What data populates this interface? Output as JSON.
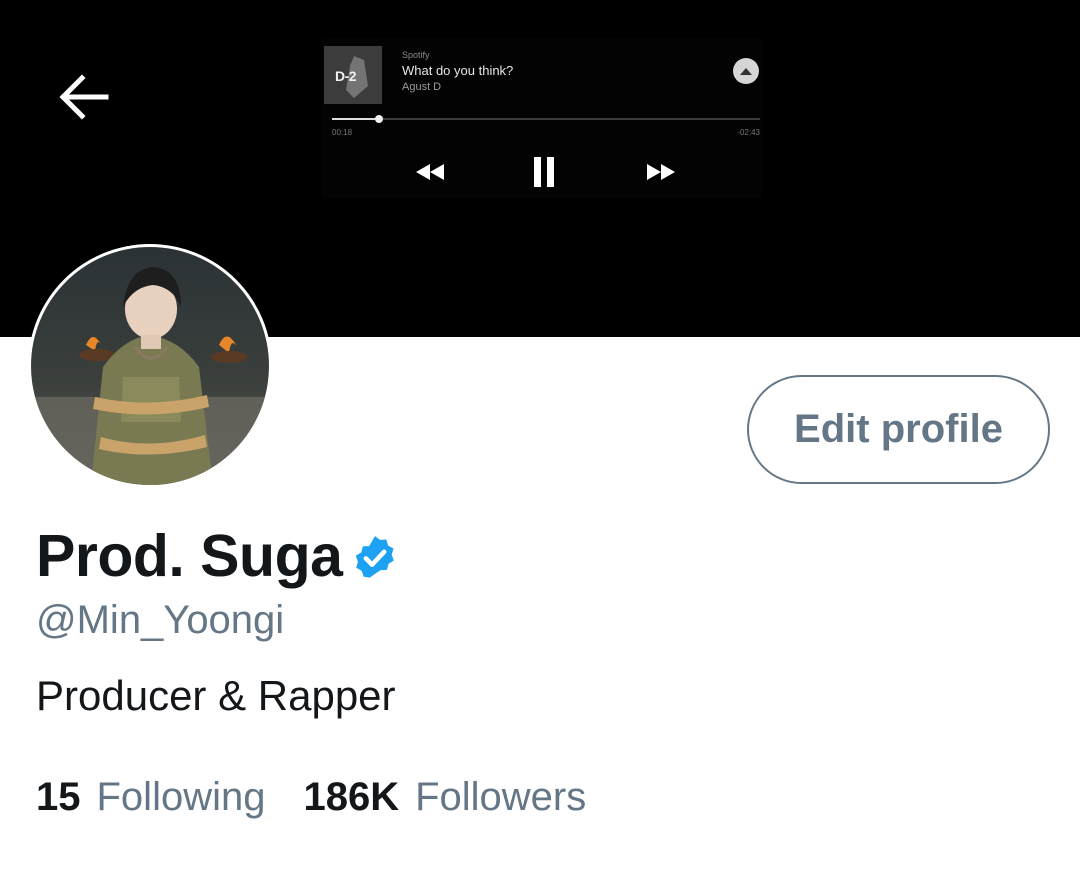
{
  "header": {
    "back_icon": "arrow-left-icon"
  },
  "banner": {
    "background": "#000000",
    "player": {
      "art_label": "D-2",
      "source": "Spotify",
      "track": "What do you think?",
      "artist": "Agust D",
      "progress": 0.11,
      "elapsed": "00:18",
      "remaining": "-02:43",
      "cast_icon": "cast-icon",
      "controls": [
        "rewind-icon",
        "pause-icon",
        "fast-forward-icon"
      ]
    }
  },
  "profile": {
    "name": "Prod. Suga",
    "verified_icon": "verified-badge-icon",
    "handle": "@Min_Yoongi",
    "bio": "Producer & Rapper",
    "edit_label": "Edit profile",
    "stats": {
      "following_count": "15",
      "following_label": "Following",
      "followers_count": "186K",
      "followers_label": "Followers"
    }
  },
  "colors": {
    "text_primary": "#14171a",
    "text_secondary": "#657786",
    "verified_blue": "#1da1f2"
  }
}
